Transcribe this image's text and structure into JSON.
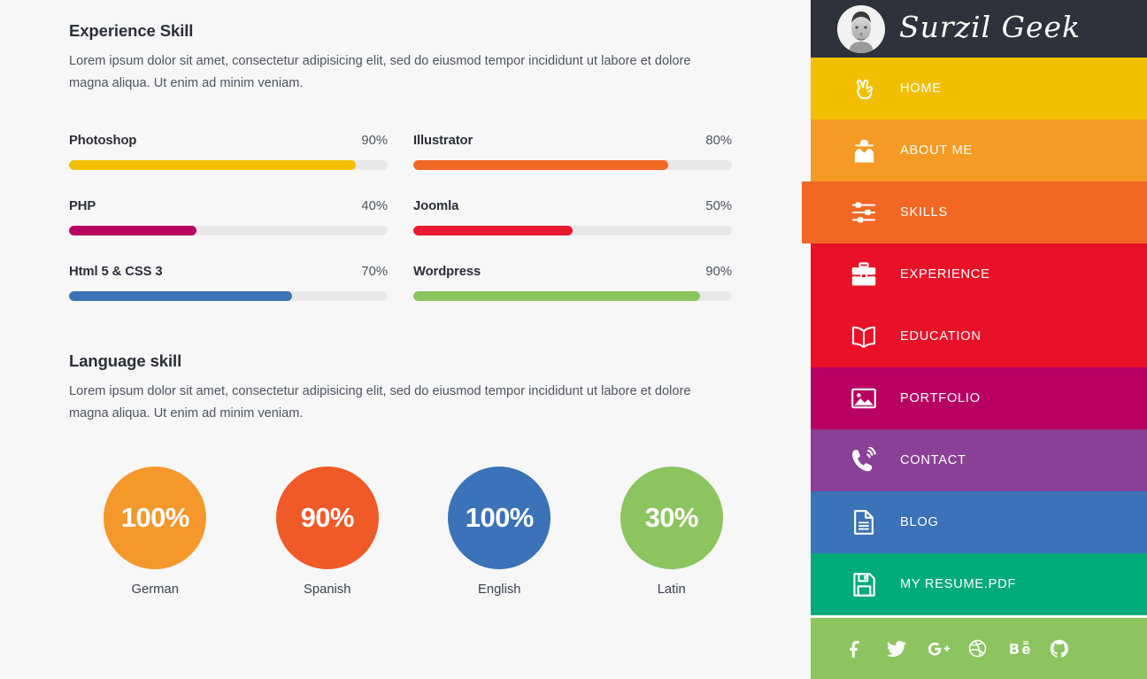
{
  "main": {
    "experience": {
      "title": "Experience Skill",
      "description": "Lorem ipsum dolor sit amet, consectetur adipisicing elit, sed do eiusmod tempor incididunt ut labore et dolore magna aliqua. Ut enim ad minim veniam."
    },
    "language": {
      "title": "Language skill",
      "description": "Lorem ipsum dolor sit amet, consectetur adipisicing elit, sed do eiusmod tempor incididunt ut labore et dolore magna aliqua. Ut enim ad minim veniam."
    },
    "skills": [
      {
        "name": "Photoshop",
        "percent_label": "90%",
        "percent": 90,
        "color": "#f2bf00",
        "track": "#e8e8e8"
      },
      {
        "name": "Illustrator",
        "percent_label": "80%",
        "percent": 80,
        "color": "#f26724",
        "track": "#e8e8e8"
      },
      {
        "name": "PHP",
        "percent_label": "40%",
        "percent": 40,
        "color": "#b80063",
        "track": "#e8e8e8"
      },
      {
        "name": "Joomla",
        "percent_label": "50%",
        "percent": 50,
        "color": "#e81b32",
        "track": "#e8e8e8"
      },
      {
        "name": "Html 5 & CSS 3",
        "percent_label": "70%",
        "percent": 70,
        "color": "#3b72b8",
        "track": "#e8e8e8"
      },
      {
        "name": "Wordpress",
        "percent_label": "90%",
        "percent": 90,
        "color": "#8cc45f",
        "track": "#e8e8e8"
      }
    ],
    "languages": [
      {
        "label": "German",
        "percent_label": "100%",
        "percent": 100,
        "color": "#f5982b"
      },
      {
        "label": "Spanish",
        "percent_label": "90%",
        "percent": 90,
        "color": "#f05a28"
      },
      {
        "label": "English",
        "percent_label": "100%",
        "percent": 100,
        "color": "#3b72b8"
      },
      {
        "label": "Latin",
        "percent_label": "30%",
        "percent": 30,
        "color": "#8cc45f"
      }
    ]
  },
  "sidebar": {
    "brand": {
      "name": "Surzil Geek",
      "avatar_icon": "user-avatar-photo",
      "background": "#2e323c"
    },
    "items": [
      {
        "label": "HOME",
        "icon": "peace-hand-icon",
        "color": "#f2bf00",
        "active": false
      },
      {
        "label": "ABOUT ME",
        "icon": "spy-person-icon",
        "color": "#f59a23",
        "active": false
      },
      {
        "label": "SKILLS",
        "icon": "sliders-icon",
        "color": "#f26724",
        "active": true
      },
      {
        "label": "EXPERIENCE",
        "icon": "briefcase-icon",
        "color": "#e81128",
        "active": false
      },
      {
        "label": "EDUCATION",
        "icon": "open-book-icon",
        "color": "#e81128",
        "active": false
      },
      {
        "label": "PORTFOLIO",
        "icon": "image-icon",
        "color": "#b80063",
        "active": false
      },
      {
        "label": "CONTACT",
        "icon": "phone-ring-icon",
        "color": "#8a4096",
        "active": false
      },
      {
        "label": "BLOG",
        "icon": "document-icon",
        "color": "#3b72b8",
        "active": false
      },
      {
        "label": "MY RESUME.PDF",
        "icon": "floppy-disk-icon",
        "color": "#00ab7b",
        "active": false
      }
    ],
    "social": [
      {
        "name": "facebook-icon",
        "glyph": "f"
      },
      {
        "name": "twitter-icon",
        "glyph": "t"
      },
      {
        "name": "google-plus-icon",
        "glyph": "G+"
      },
      {
        "name": "dribbble-icon",
        "glyph": "d"
      },
      {
        "name": "behance-icon",
        "glyph": "Bē"
      },
      {
        "name": "github-icon",
        "glyph": "gh"
      }
    ],
    "social_background": "#8cc45f"
  }
}
